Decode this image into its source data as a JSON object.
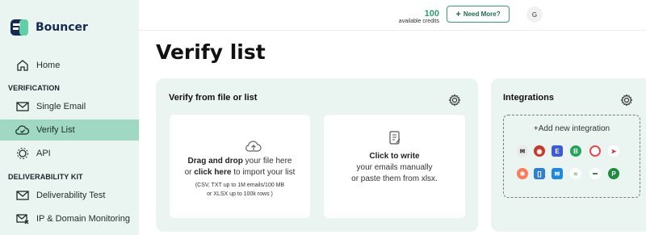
{
  "app": {
    "name": "Bouncer"
  },
  "sidebar": {
    "home": "Home",
    "section_verification": "VERIFICATION",
    "single_email": "Single Email",
    "verify_list": "Verify List",
    "api": "API",
    "section_deliverability": "DELIVERABILITY KIT",
    "deliverability_test": "Deliverability Test",
    "ip_domain_monitoring": "IP & Domain Monitoring"
  },
  "topbar": {
    "credits_value": "100",
    "credits_label": "available credits",
    "need_more": "Need More?",
    "avatar_initial": "G"
  },
  "main": {
    "title": "Verify list",
    "verify_card_title": "Verify from file or list",
    "upload": {
      "drag_bold": "Drag and drop",
      "drag_rest": " your file here",
      "or": "or ",
      "click_bold": "click here",
      "click_rest": " to import your list",
      "limits1": "(CSV, TXT up to 1M emails/100 MB",
      "limits2": "or XLSX up to 100k rows )"
    },
    "write": {
      "bold": "Click to write",
      "line2": "your emails manually",
      "line3": "or paste them from xlsx."
    }
  },
  "integrations": {
    "title": "Integrations",
    "add": "+Add new integration"
  },
  "colors": {
    "accent": "#2f9e72",
    "active_nav": "#9fd9c4",
    "panel": "#eaf5f2",
    "brand_dark": "#142a52"
  }
}
